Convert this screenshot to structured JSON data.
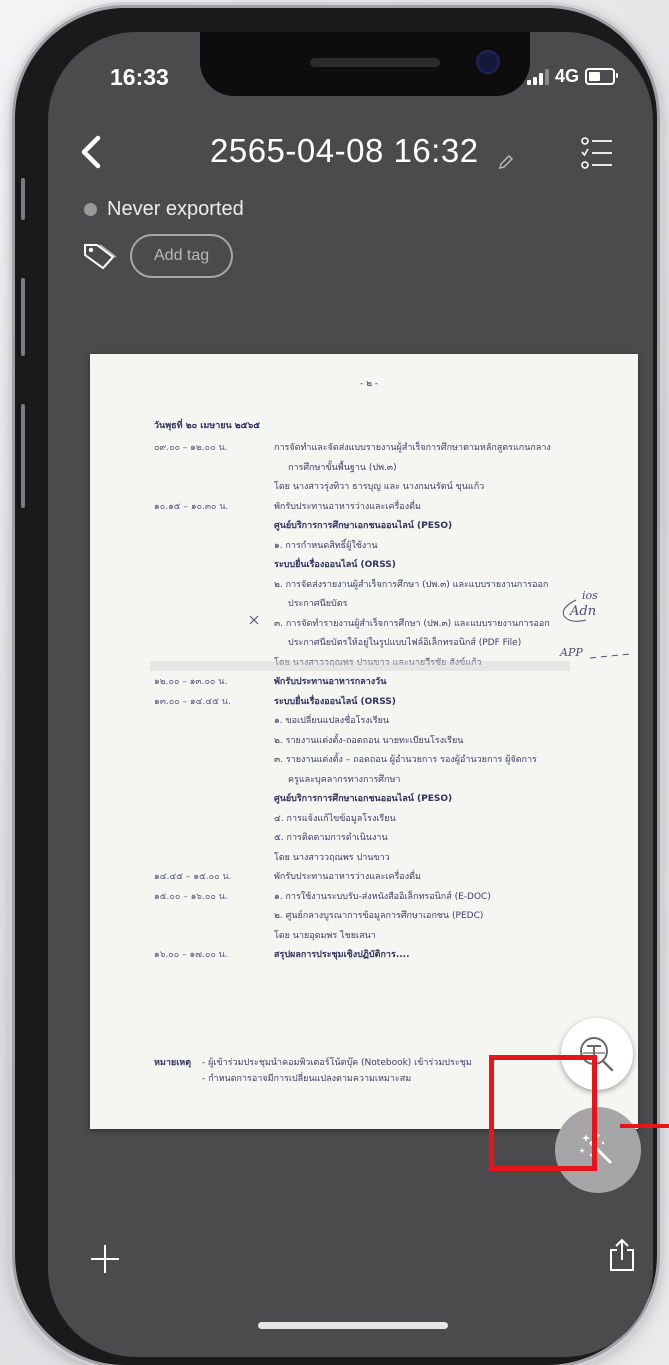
{
  "status_bar": {
    "time": "16:33",
    "network": "4G"
  },
  "header": {
    "title": "2565-04-08 16:32",
    "export_status": "Never exported",
    "add_tag_label": "Add tag"
  },
  "document": {
    "page_number": "- ๒ -",
    "date_line": "วันพุธที่ ๒๐ เมษายน ๒๕๖๕",
    "lines": [
      {
        "time": "๐๙.๐๐ – ๑๒.๐๐ น.",
        "text": "การจัดทำและจัดส่งแบบรายงานผู้สำเร็จการศึกษาตามหลักสูตรแกนกลาง"
      },
      {
        "time": "",
        "text": "การศึกษาขั้นพื้นฐาน (ปพ.๓)"
      },
      {
        "time": "",
        "text": "โดย นางสาวรุ่งทิวา ธารบุญ และ นางกมนรัตน์ ขุนแก้ว"
      },
      {
        "time": "๑๐.๑๕ – ๑๐.๓๐ น.",
        "text": "พักรับประทานอาหารว่างและเครื่องดื่ม"
      },
      {
        "time": "",
        "text": "ศูนย์บริการการศึกษาเอกชนออนไลน์ (PESO)",
        "bold": true
      },
      {
        "time": "",
        "text": "๑. การกำหนดสิทธิ์ผู้ใช้งาน"
      },
      {
        "time": "",
        "text": "ระบบยื่นเรื่องออนไลน์ (ORSS)",
        "bold": true
      },
      {
        "time": "",
        "text": "๒. การจัดส่งรายงานผู้สำเร็จการศึกษา (ปพ.๓) และแบบรายงานการออก"
      },
      {
        "time": "",
        "text": "ประกาศนียบัตร"
      },
      {
        "time": "",
        "text": "๓. การจัดทำรายงานผู้สำเร็จการศึกษา (ปพ.๓) และแบบรายงานการออก"
      },
      {
        "time": "",
        "text": "ประกาศนียบัตรให้อยู่ในรูปแบบไฟล์อิเล็กทรอนิกส์ (PDF File)"
      },
      {
        "time": "",
        "text": "โดย นางสาววฤณพร ปานขาว และนายวีรชัย สังข์แก้ว"
      },
      {
        "time": "๑๒.๐๐ – ๑๓.๐๐ น.",
        "text": "พักรับประทานอาหารกลางวัน",
        "bold": true
      },
      {
        "time": "๑๓.๐๐ – ๑๔.๔๕ น.",
        "text": "ระบบยื่นเรื่องออนไลน์ (ORSS)",
        "bold": true
      },
      {
        "time": "",
        "text": "๑. ขอเปลี่ยนแปลงชื่อโรงเรียน"
      },
      {
        "time": "",
        "text": "๒. รายงานแต่งตั้ง-ถอดถอน นายทะเบียนโรงเรียน"
      },
      {
        "time": "",
        "text": "๓. รายงานแต่งตั้ง – ถอดถอน ผู้อำนวยการ รองผู้อำนวยการ ผู้จัดการ"
      },
      {
        "time": "",
        "text": "ครูและบุคลากรทางการศึกษา"
      },
      {
        "time": "",
        "text": "ศูนย์บริการการศึกษาเอกชนออนไลน์ (PESO)",
        "bold": true
      },
      {
        "time": "",
        "text": "๔. การแจ้งแก้ไขข้อมูลโรงเรียน"
      },
      {
        "time": "",
        "text": "๕. การติดตามการดำเนินงาน"
      },
      {
        "time": "",
        "text": "โดย นางสาววฤณพร ปานขาว"
      },
      {
        "time": "๑๔.๔๕ – ๑๕.๐๐ น.",
        "text": "พักรับประทานอาหารว่างและเครื่องดื่ม"
      },
      {
        "time": "๑๕.๐๐ – ๑๖.๐๐ น.",
        "text": "๑. การใช้งานระบบรับ-ส่งหนังสืออิเล็กทรอนิกส์ (E-DOC)"
      },
      {
        "time": "",
        "text": "๒. ศูนย์กลางบูรณาการข้อมูลการศึกษาเอกชน (PEDC)"
      },
      {
        "time": "",
        "text": "โดย นายอุดมพร ไชยเสนา"
      },
      {
        "time": "๑๖.๐๐ – ๑๗.๐๐ น.",
        "text": "สรุปผลการประชุมเชิงปฏิบัติการ....",
        "bold": true
      }
    ],
    "note_label": "หมายเหตุ",
    "note_1": "- ผู้เข้าร่วมประชุมนำคอมพิวเตอร์โน้ตบุ๊ค (Notebook) เข้าร่วมประชุม",
    "note_2": "- กำหนดการอาจมีการเปลี่ยนแปลงตามความเหมาะสม",
    "handwriting": [
      "ios",
      "Adn",
      "APP"
    ]
  }
}
